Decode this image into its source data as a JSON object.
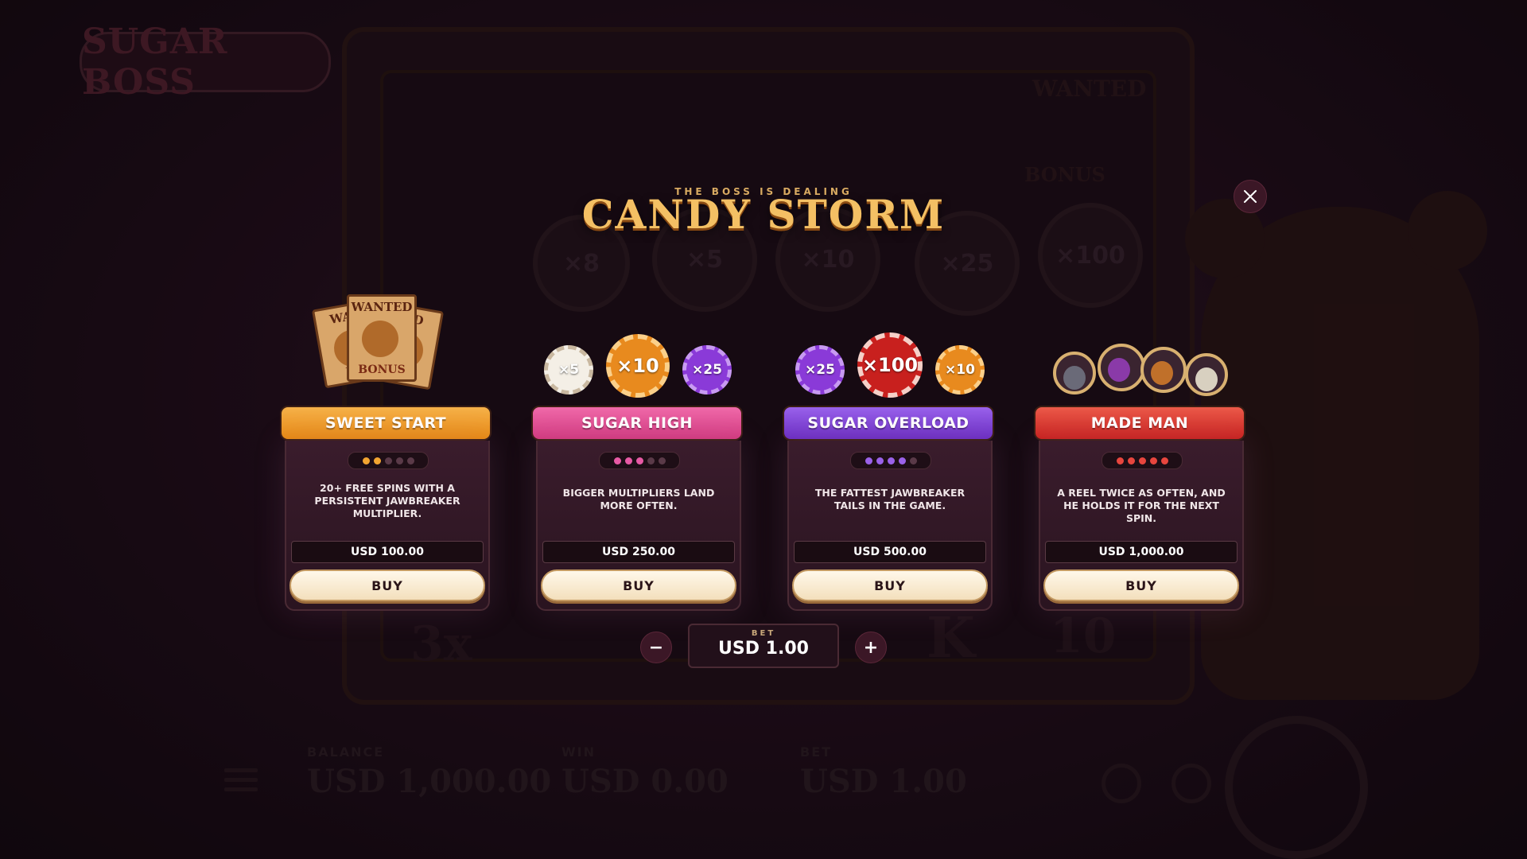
{
  "background": {
    "logo": "SUGAR BOSS",
    "symbols": [
      "×8",
      "×5",
      "×10",
      "×25",
      "×100"
    ],
    "reel_text": [
      "3x",
      "K",
      "10"
    ],
    "wanted": "WANTED",
    "bonus": "BONUS",
    "balance_label": "BALANCE",
    "balance_value": "USD 1,000.00",
    "win_label": "WIN",
    "win_value": "USD 0.00",
    "bet_label": "BET",
    "bet_value": "USD 1.00"
  },
  "header": {
    "subtitle": "THE BOSS IS DEALING",
    "title": "CANDY STORM"
  },
  "cards": [
    {
      "name": "SWEET START",
      "level": 2,
      "description": "20+ FREE SPINS WITH A PERSISTENT JAWBREAKER MULTIPLIER.",
      "price": "USD 100.00",
      "button": "BUY",
      "color": "#f0961e",
      "dot_color": "#f2a531",
      "posters": [
        "WANTED",
        "WAN",
        "TED"
      ],
      "poster_bonus": [
        "BONUS",
        "BO"
      ]
    },
    {
      "name": "SUGAR HIGH",
      "level": 3,
      "description": "BIGGER MULTIPLIERS LAND MORE OFTEN.",
      "price": "USD 250.00",
      "button": "BUY",
      "color": "#e0458f",
      "dot_color": "#e85aa5",
      "chips": [
        "×5",
        "×10",
        "×25"
      ]
    },
    {
      "name": "SUGAR OVERLOAD",
      "level": 4,
      "description": "THE FATTEST JAWBREAKER TAILS IN THE GAME.",
      "price": "USD 500.00",
      "button": "BUY",
      "color": "#7d3fd0",
      "dot_color": "#9a62e8",
      "chips": [
        "×25",
        "×100",
        "×10"
      ]
    },
    {
      "name": "MADE MAN",
      "level": 5,
      "description": "A REEL TWICE AS OFTEN, AND HE HOLDS IT FOR THE NEXT SPIN.",
      "price": "USD 1,000.00",
      "button": "BUY",
      "color": "#d9322e",
      "dot_color": "#e8463e"
    }
  ],
  "bet": {
    "label": "BET",
    "value": "USD 1.00",
    "minus": "−",
    "plus": "+"
  },
  "icons": {
    "close": "close-icon",
    "minus": "minus-icon",
    "plus": "plus-icon"
  }
}
